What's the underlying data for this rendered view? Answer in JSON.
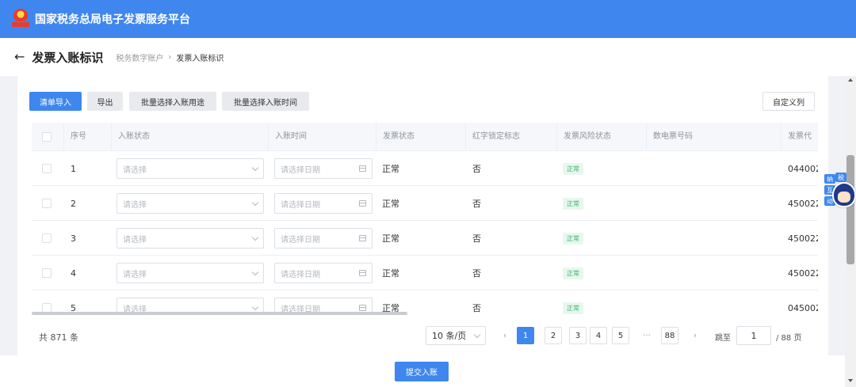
{
  "app": {
    "title": "国家税务总局电子发票服务平台"
  },
  "header": {
    "title": "发票入账标识",
    "breadcrumb": [
      "税务数字账户",
      "发票入账标识"
    ],
    "breadcrumb_sep": "›"
  },
  "toolbar": {
    "import_label": "清单导入",
    "export_label": "导出",
    "batch_purpose_label": "批量选择入账用途",
    "batch_time_label": "批量选择入账时间",
    "custom_columns_label": "自定义列"
  },
  "table": {
    "columns": [
      "序号",
      "入账状态",
      "入账时间",
      "发票状态",
      "红字锁定标志",
      "发票风险状态",
      "数电票号码",
      "发票代"
    ],
    "select_placeholder": "请选择",
    "date_placeholder": "请选择日期",
    "rows": [
      {
        "index": "1",
        "invoice_status": "正常",
        "red_lock": "否",
        "risk_status": "正常",
        "invoice_code": "044002"
      },
      {
        "index": "2",
        "invoice_status": "正常",
        "red_lock": "否",
        "risk_status": "正常",
        "invoice_code": "450022"
      },
      {
        "index": "3",
        "invoice_status": "正常",
        "red_lock": "否",
        "risk_status": "正常",
        "invoice_code": "450022"
      },
      {
        "index": "4",
        "invoice_status": "正常",
        "red_lock": "否",
        "risk_status": "正常",
        "invoice_code": "450022"
      },
      {
        "index": "5",
        "invoice_status": "正常",
        "red_lock": "否",
        "risk_status": "正常",
        "invoice_code": "045002"
      }
    ]
  },
  "pagination": {
    "total_text": "共 871 条",
    "page_size": "10 条/页",
    "prev_icon": "‹",
    "next_icon": "›",
    "pages": [
      "1",
      "2",
      "3",
      "4",
      "5"
    ],
    "ellipsis": "···",
    "last_page": "88",
    "current_page": 1,
    "jump_label": "跳至",
    "jump_value": "1",
    "jump_total": "/ 88 页"
  },
  "footer": {
    "submit_label": "提交入账"
  },
  "assistant": {
    "tags": [
      "纳",
      "税",
      "互",
      "动"
    ]
  },
  "colors": {
    "primary": "#3f87ee",
    "risk_ok_bg": "#e8f7ee",
    "risk_ok_text": "#39b36b"
  },
  "icons": {
    "back": "arrow-left-icon",
    "select": "chevron-down-icon",
    "date": "calendar-icon",
    "logo": "tax-emblem-icon"
  }
}
